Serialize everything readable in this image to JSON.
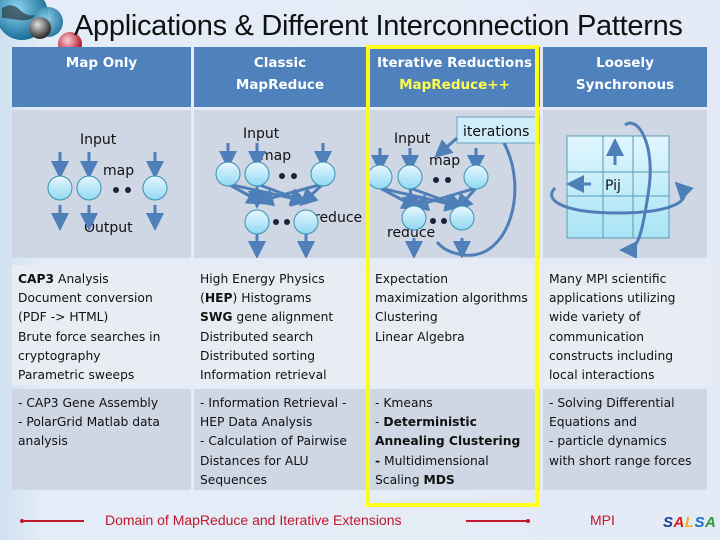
{
  "title": "Applications & Different Interconnection Patterns",
  "columns": [
    {
      "header_line1": "Map Only",
      "header_line2": ""
    },
    {
      "header_line1": "Classic",
      "header_line2": "MapReduce"
    },
    {
      "header_line1": "Iterative Reductions",
      "header_line2": "MapReduce++"
    },
    {
      "header_line1": "Loosely",
      "header_line2": "Synchronous"
    }
  ],
  "diagrams": {
    "map_only": {
      "input": "Input",
      "map": "map",
      "output": "Output"
    },
    "classic": {
      "input": "Input",
      "map": "map",
      "reduce": "reduce"
    },
    "iterative": {
      "input": "Input",
      "map": "map",
      "reduce": "reduce",
      "iterations": "iterations"
    },
    "loosely": {
      "cell_label": "Pij"
    }
  },
  "applications": [
    [
      [
        {
          "b": "CAP3"
        },
        {
          "t": " Analysis"
        }
      ],
      [
        {
          "t": "Document conversion"
        }
      ],
      [
        {
          "t": "(PDF -> HTML)"
        }
      ],
      [
        {
          "t": "Brute force searches in"
        }
      ],
      [
        {
          "t": "cryptography"
        }
      ],
      [
        {
          "t": "Parametric sweeps"
        }
      ]
    ],
    [
      [
        {
          "t": "High Energy Physics"
        }
      ],
      [
        {
          "t": "("
        },
        {
          "b": "HEP"
        },
        {
          "t": ") Histograms"
        }
      ],
      [
        {
          "b": "SWG"
        },
        {
          "t": " gene alignment"
        }
      ],
      [
        {
          "t": "Distributed search"
        }
      ],
      [
        {
          "t": "Distributed sorting"
        }
      ],
      [
        {
          "t": "Information retrieval"
        }
      ]
    ],
    [
      [
        {
          "t": "Expectation"
        }
      ],
      [
        {
          "t": "maximization algorithms"
        }
      ],
      [
        {
          "t": "Clustering"
        }
      ],
      [
        {
          "t": "Linear Algebra"
        }
      ]
    ],
    [
      [
        {
          "t": "Many MPI scientific"
        }
      ],
      [
        {
          "t": "applications utilizing"
        }
      ],
      [
        {
          "t": "wide variety of"
        }
      ],
      [
        {
          "t": "communication"
        }
      ],
      [
        {
          "t": "constructs including"
        }
      ],
      [
        {
          "t": "local interactions"
        }
      ]
    ]
  ],
  "examples": [
    [
      [
        {
          "t": "- CAP3 Gene Assembly"
        }
      ],
      [
        {
          "t": "- PolarGrid Matlab data"
        }
      ],
      [
        {
          "t": "analysis"
        }
      ]
    ],
    [
      [
        {
          "t": "- Information Retrieval -"
        }
      ],
      [
        {
          "t": "HEP Data Analysis"
        }
      ],
      [
        {
          "t": "- Calculation of Pairwise"
        }
      ],
      [
        {
          "t": "Distances for ALU"
        }
      ],
      [
        {
          "t": "Sequences"
        }
      ]
    ],
    [
      [
        {
          "t": "- Kmeans"
        }
      ],
      [
        {
          "t": "- "
        },
        {
          "b": "Deterministic"
        }
      ],
      [
        {
          "b": "Annealing Clustering"
        }
      ],
      [
        {
          "b": "-"
        },
        {
          "t": " Multidimensional"
        }
      ],
      [
        {
          "t": "Scaling "
        },
        {
          "b": "MDS"
        }
      ]
    ],
    [
      [
        {
          "t": "- Solving Differential"
        }
      ],
      [
        {
          "t": "Equations and"
        }
      ],
      [
        {
          "t": "- particle dynamics"
        }
      ],
      [
        {
          "t": "with short range forces"
        }
      ]
    ]
  ],
  "footer": {
    "domain_label": "Domain of MapReduce and Iterative Extensions",
    "mpi_label": "MPI",
    "logo_letters": [
      {
        "ch": "S",
        "color": "#1f3f9a"
      },
      {
        "ch": "A",
        "color": "#d42020"
      },
      {
        "ch": "L",
        "color": "#f2b01e"
      },
      {
        "ch": "S",
        "color": "#1f6fc0"
      },
      {
        "ch": "A",
        "color": "#2a9a3a"
      }
    ]
  },
  "colors": {
    "header_bg": "#4f81bd",
    "highlight": "#ffff1a",
    "footer_red": "#c0172a",
    "arrow_blue": "#4f7fb8"
  }
}
